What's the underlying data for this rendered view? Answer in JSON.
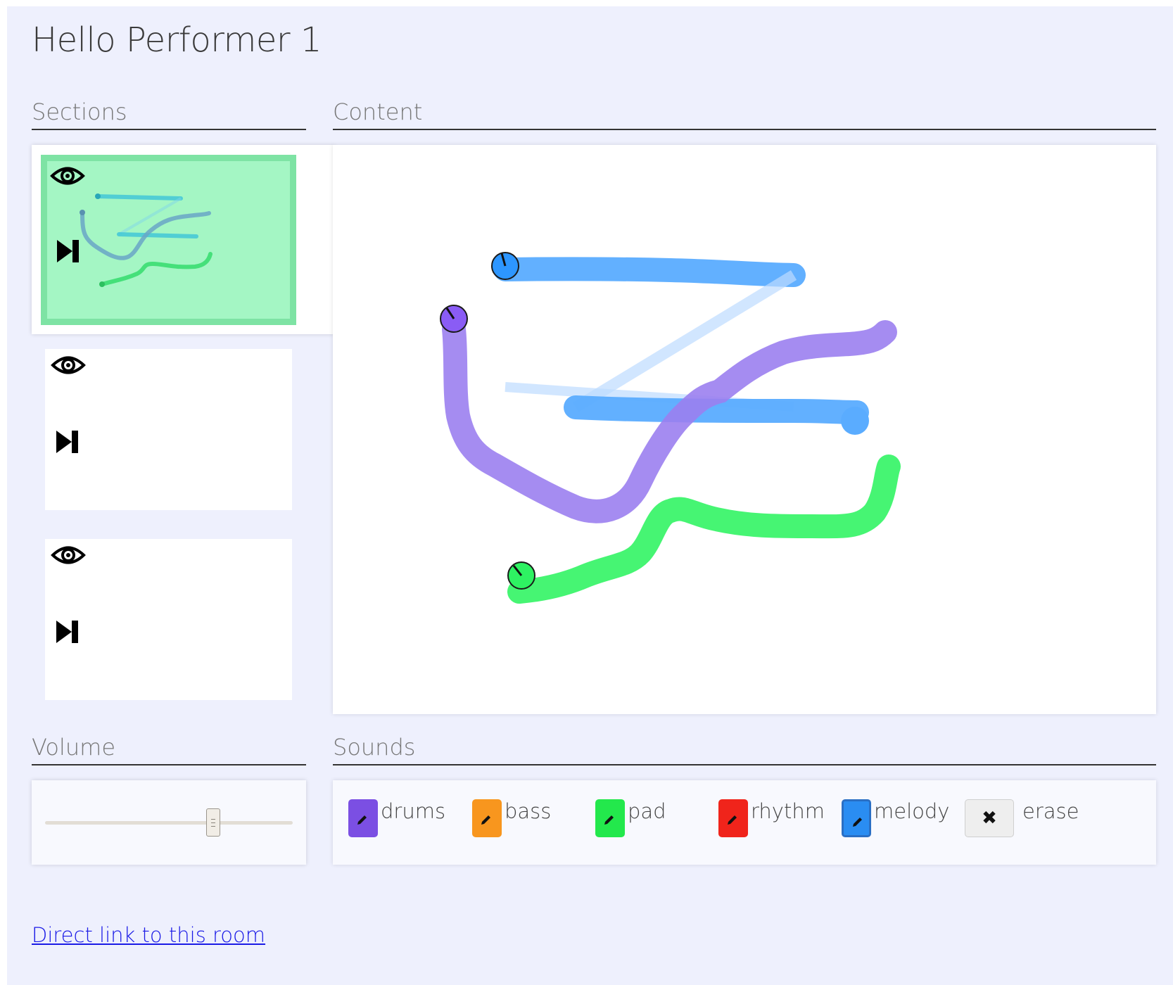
{
  "header": {
    "title": "Hello Performer 1"
  },
  "sections_panel": {
    "heading": "Sections",
    "items": [
      {
        "selected": true,
        "eye_icon": "eye-icon",
        "skip_icon": "skip-forward-icon"
      },
      {
        "selected": false,
        "eye_icon": "eye-icon",
        "skip_icon": "skip-forward-icon"
      },
      {
        "selected": false,
        "eye_icon": "eye-icon",
        "skip_icon": "skip-forward-icon"
      }
    ]
  },
  "content_panel": {
    "heading": "Content",
    "strokes": [
      {
        "sound": "melody",
        "color": "#2d96ff"
      },
      {
        "sound": "drums",
        "color": "#8a5cf5"
      },
      {
        "sound": "pad",
        "color": "#2ef262"
      }
    ]
  },
  "volume_panel": {
    "heading": "Volume",
    "level": 0.68
  },
  "sounds_panel": {
    "heading": "Sounds",
    "items": [
      {
        "label": "drums",
        "color": "#7b4fe3",
        "icon": "pencil-icon"
      },
      {
        "label": "bass",
        "color": "#f8961e",
        "icon": "pencil-icon"
      },
      {
        "label": "pad",
        "color": "#23e84c",
        "icon": "pencil-icon"
      },
      {
        "label": "rhythm",
        "color": "#f0241b",
        "icon": "pencil-icon"
      },
      {
        "label": "melody",
        "color": "#2a8df2",
        "icon": "pencil-icon",
        "selected": true
      },
      {
        "label": "erase",
        "color": "#eeeeee",
        "icon": "close-icon"
      }
    ]
  },
  "footer": {
    "link_text": "Direct link to this room"
  },
  "colors": {
    "page_bg": "#eef0fd",
    "selected_section": "#a4f6c4",
    "link": "#1a1ae6"
  }
}
